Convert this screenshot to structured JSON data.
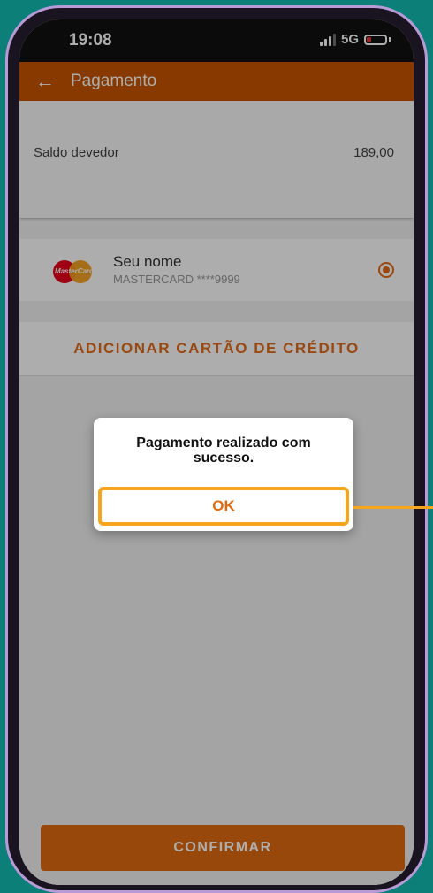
{
  "status_bar": {
    "time": "19:08",
    "network": "5G"
  },
  "app_bar": {
    "title": "Pagamento"
  },
  "balance": {
    "label": "Saldo devedor",
    "value": "189,00"
  },
  "card": {
    "brand_text": "MasterCard",
    "name": "Seu nome",
    "number": "MASTERCARD ****9999",
    "selected": true
  },
  "add_card": {
    "label": "ADICIONAR CARTÃO DE CRÉDITO"
  },
  "dialog": {
    "message": "Pagamento realizado com sucesso.",
    "ok_label": "OK"
  },
  "confirm": {
    "label": "CONFIRMAR"
  },
  "colors": {
    "accent": "#c75400",
    "highlight": "#f7a51d",
    "background": "#0b7f78"
  }
}
